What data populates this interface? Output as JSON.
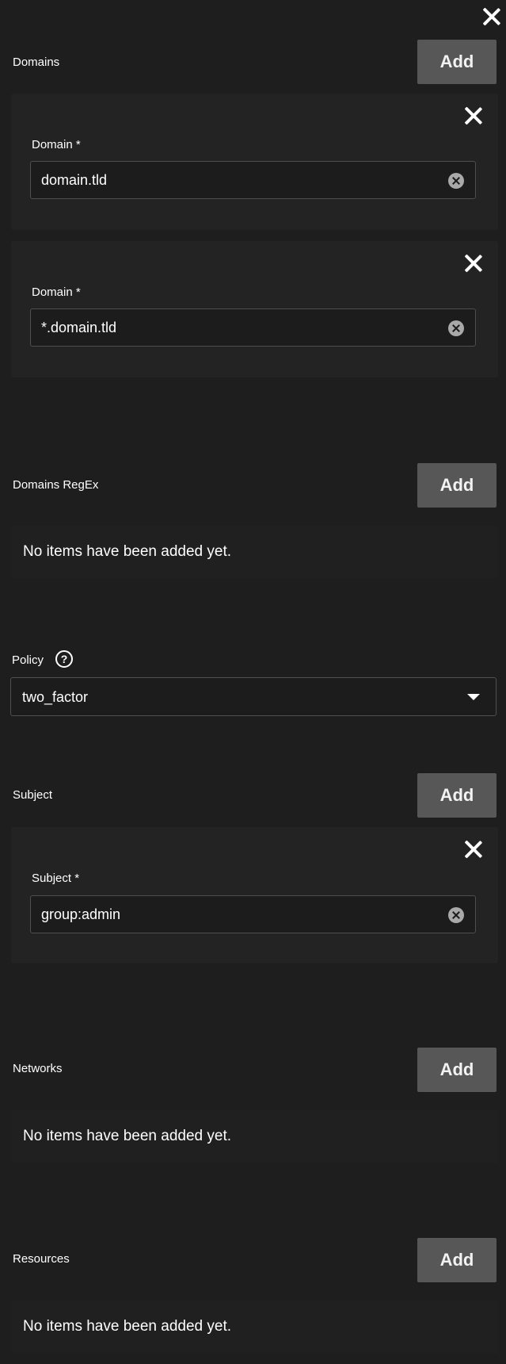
{
  "dialog": {
    "close_icon": "close-icon"
  },
  "domains": {
    "label": "Domains",
    "add_label": "Add",
    "items": [
      {
        "field_label": "Domain *",
        "value": "domain.tld"
      },
      {
        "field_label": "Domain *",
        "value": "*.domain.tld"
      }
    ]
  },
  "domains_regex": {
    "label": "Domains RegEx",
    "add_label": "Add",
    "empty_message": "No items have been added yet."
  },
  "policy": {
    "label": "Policy",
    "help_icon_glyph": "?",
    "selected": "two_factor"
  },
  "subject": {
    "label": "Subject",
    "add_label": "Add",
    "items": [
      {
        "field_label": "Subject *",
        "value": "group:admin"
      }
    ]
  },
  "networks": {
    "label": "Networks",
    "add_label": "Add",
    "empty_message": "No items have been added yet."
  },
  "resources": {
    "label": "Resources",
    "add_label": "Add",
    "empty_message": "No items have been added yet."
  },
  "colors": {
    "background": "#1e1e1e",
    "card": "#232323",
    "button": "#575757",
    "field_border": "#4f4f4f"
  }
}
